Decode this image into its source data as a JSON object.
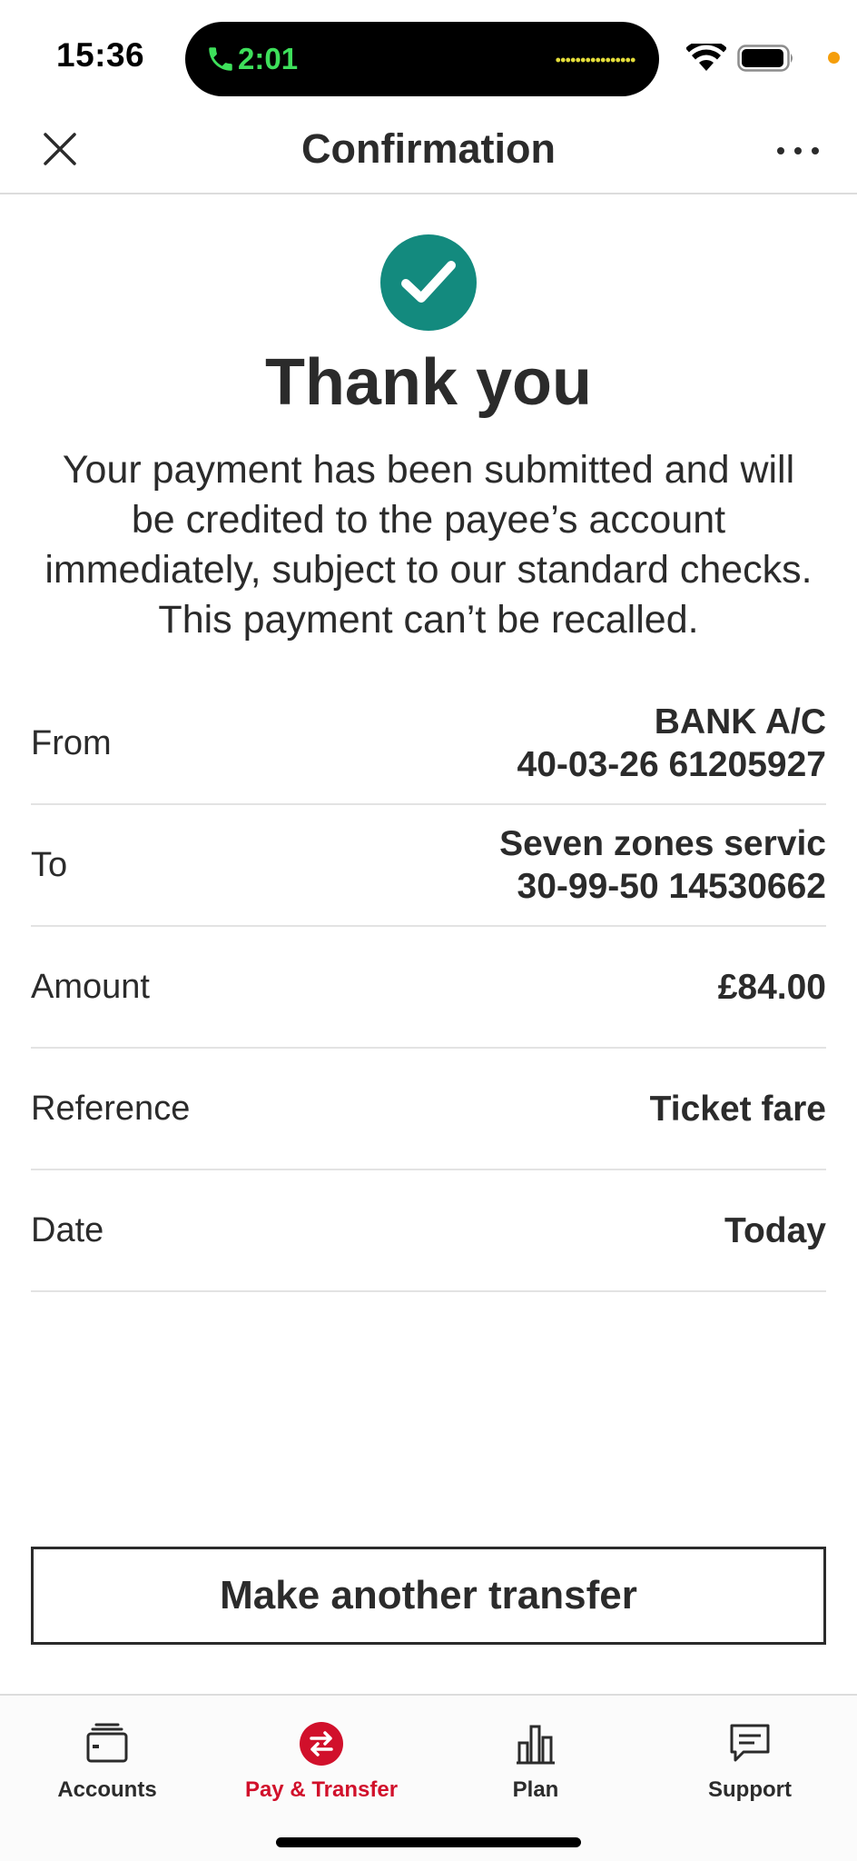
{
  "status_bar": {
    "time": "15:36",
    "call_duration": "2:01",
    "icons": [
      "phone-icon",
      "wifi-icon",
      "battery-icon"
    ],
    "call_color": "#3ee05b",
    "indicator_color": "#f59e0b"
  },
  "header": {
    "title": "Confirmation",
    "close_icon": "close-icon",
    "more_icon": "more-icon"
  },
  "confirmation": {
    "icon": "check-circle-icon",
    "icon_color": "#138a7e",
    "title": "Thank you",
    "message": "Your payment has been submitted and will be credited to the payee’s account immediately, subject to our standard checks. This payment can’t be recalled."
  },
  "details": [
    {
      "label": "From",
      "value_line1": "BANK A/C",
      "value_line2": "40-03-26 61205927"
    },
    {
      "label": "To",
      "value_line1": "Seven zones servic",
      "value_line2": "30-99-50 14530662"
    },
    {
      "label": "Amount",
      "value_line1": "£84.00"
    },
    {
      "label": "Reference",
      "value_line1": "Ticket fare"
    },
    {
      "label": "Date",
      "value_line1": "Today"
    }
  ],
  "actions": {
    "make_another_transfer": "Make another transfer"
  },
  "bottom_nav": {
    "accent_color": "#d1102b",
    "items": [
      {
        "label": "Accounts",
        "icon": "wallet-icon",
        "active": false
      },
      {
        "label": "Pay & Transfer",
        "icon": "transfer-icon",
        "active": true
      },
      {
        "label": "Plan",
        "icon": "bar-chart-icon",
        "active": false
      },
      {
        "label": "Support",
        "icon": "chat-icon",
        "active": false
      }
    ]
  }
}
